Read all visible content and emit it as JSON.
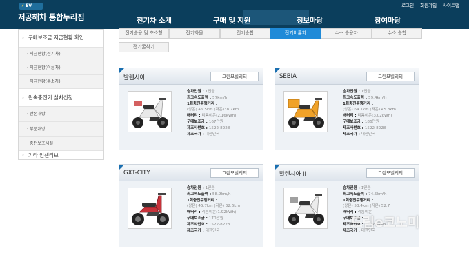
{
  "header": {
    "badge": "EV",
    "site_title": "저공해차 통합누리집",
    "nav": [
      "전기차 소개",
      "구매 및 지원",
      "정보마당",
      "참여마당"
    ],
    "util_links": [
      "로그인",
      "회원가입",
      "사이트맵"
    ],
    "colors": {
      "bar": "#0b3e5c",
      "accent": "#1f8ad8"
    }
  },
  "sidebar": {
    "items": [
      {
        "type": "main",
        "label": "구매보조금 지급현황 확인"
      },
      {
        "type": "sub",
        "label": "· 지급현황(전기차)"
      },
      {
        "type": "sub",
        "label": "· 지급현황(이륜차)"
      },
      {
        "type": "sub",
        "label": "· 지급현황(수소차)"
      },
      {
        "type": "main",
        "label": "완속충전기 설치신청"
      },
      {
        "type": "sub",
        "label": "· 완전개방"
      },
      {
        "type": "sub",
        "label": "· 부분개방"
      },
      {
        "type": "sub",
        "label": "· 충전보조시설"
      },
      {
        "type": "main",
        "label": "기타 인센티브"
      }
    ]
  },
  "tabs": [
    {
      "label": "전기승용 및 초소형",
      "active": false
    },
    {
      "label": "전기화물",
      "active": false
    },
    {
      "label": "전기승합",
      "active": false
    },
    {
      "label": "전기이륜차",
      "active": true
    },
    {
      "label": "수소 승용차",
      "active": false
    },
    {
      "label": "수소 승합",
      "active": false
    },
    {
      "label": "전기굴착기",
      "active": false
    }
  ],
  "cards": [
    {
      "name": "발렌시아",
      "maker": "그린모빌리티",
      "scooter_color": "#e9e9e9",
      "specs": {
        "seats": {
          "k": "승차인원 : ",
          "v": "1인승"
        },
        "speed": {
          "k": "최고속도출력 : ",
          "v": "57km/h"
        },
        "range_title": {
          "k": "1회충전주행거리 :",
          "v": ""
        },
        "range": {
          "k": "",
          "v": "(상온) 46.5km  (저온)38.7km"
        },
        "battery": {
          "k": "배터리 : ",
          "v": "리튬이온(2.16kWh)"
        },
        "subsidy": {
          "k": "구매보조금 : ",
          "v": "167만원"
        },
        "phone": {
          "k": "제조사번호 : ",
          "v": "1522-8228"
        },
        "country": {
          "k": "제조국가 : ",
          "v": "대한민국"
        }
      }
    },
    {
      "name": "SEBIA",
      "maker": "그린모빌리티",
      "scooter_color": "#f0a229",
      "specs": {
        "seats": {
          "k": "승차인원 : ",
          "v": "1인승"
        },
        "speed": {
          "k": "최고속도출력 : ",
          "v": "59.4km/h"
        },
        "range_title": {
          "k": "1회충전주행거리 :",
          "v": ""
        },
        "range": {
          "k": "",
          "v": "(상온) 64.1km  (저온) 45.8km"
        },
        "battery": {
          "k": "배터리 : ",
          "v": "리튬이온(3.02kWh)"
        },
        "subsidy": {
          "k": "구매보조금 : ",
          "v": "186만원"
        },
        "phone": {
          "k": "제조사번호 : ",
          "v": "1522-8228"
        },
        "country": {
          "k": "제조국가 : ",
          "v": "대한민국"
        }
      }
    },
    {
      "name": "GXT-CITY",
      "maker": "그린모빌리티",
      "scooter_color": "#c8323a",
      "specs": {
        "seats": {
          "k": "승차인원 : ",
          "v": "1인승"
        },
        "speed": {
          "k": "최고속도출력 : ",
          "v": "58.9km/h"
        },
        "range_title": {
          "k": "1회충전주행거리 :",
          "v": ""
        },
        "range": {
          "k": "",
          "v": "(상온) 45.7km  (저온) 32.6km"
        },
        "battery": {
          "k": "배터리 : ",
          "v": "리튬이온(1.92kWh)"
        },
        "subsidy": {
          "k": "구매보조금 : ",
          "v": "170만원"
        },
        "phone": {
          "k": "제조사번호 : ",
          "v": "1522-8228"
        },
        "country": {
          "k": "제조국가 : ",
          "v": "대한민국"
        }
      }
    },
    {
      "name": "발렌시아 II",
      "maker": "그린모빌리티",
      "scooter_color": "#ececec",
      "specs": {
        "seats": {
          "k": "승차인원 : ",
          "v": "1인승"
        },
        "speed": {
          "k": "최고속도출력 : ",
          "v": "74.5km/h"
        },
        "range_title": {
          "k": "1회충전주행거리 :",
          "v": ""
        },
        "range": {
          "k": "",
          "v": "(상온) 53.4km  (저온) 52.7"
        },
        "battery": {
          "k": "배터리 : ",
          "v": "리튬이온"
        },
        "subsidy": {
          "k": "구매보조금 : ",
          "v": ""
        },
        "phone": {
          "k": "제조사번호 : ",
          "v": "1522-8228"
        },
        "country": {
          "k": "제조국가 : ",
          "v": "대한민국"
        }
      }
    }
  ],
  "watermark": {
    "text": "드림e코노미"
  }
}
